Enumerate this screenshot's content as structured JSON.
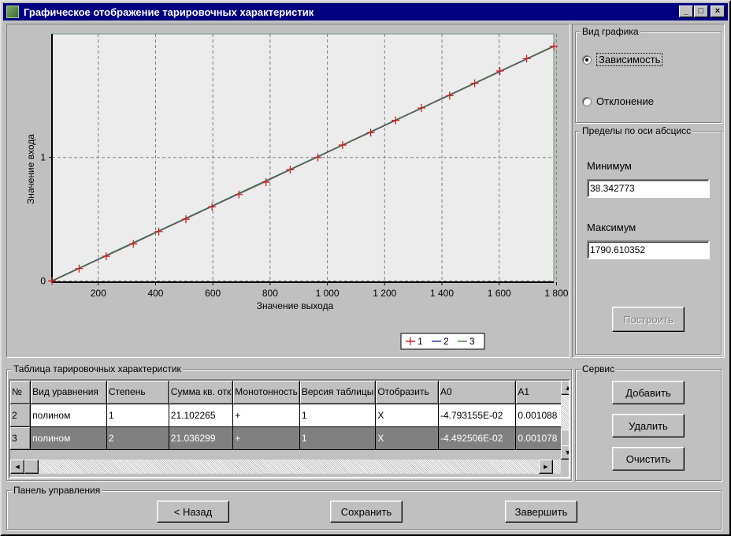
{
  "window": {
    "title": "Графическое отображение тарировочных характеристик",
    "min_glyph": "_",
    "max_glyph": "□",
    "close_glyph": "×"
  },
  "chart_data": {
    "type": "line",
    "xlabel": "Значение выхода",
    "ylabel": "Значение входа",
    "x_ticks": [
      "200",
      "400",
      "600",
      "800",
      "1 000",
      "1 200",
      "1 400",
      "1 600",
      "1 800"
    ],
    "x_tick_values": [
      200,
      400,
      600,
      800,
      1000,
      1200,
      1400,
      1600,
      1800
    ],
    "y_ticks": [
      "0",
      "1"
    ],
    "y_tick_values": [
      0,
      1
    ],
    "xlim": [
      38.342773,
      1790.610352
    ],
    "ylim": [
      -0.01,
      2.0
    ],
    "grid": true,
    "legend_position": "bottom-right",
    "series": [
      {
        "name": "1",
        "color": "#cc2222",
        "marker": "+",
        "x": [
          38.3,
          133.1,
          227.6,
          322.4,
          411.2,
          506.0,
          597.3,
          691.0,
          785.6,
          870.2,
          966.9,
          1053.0,
          1151.3,
          1238.3,
          1328.6,
          1427.0,
          1514.3,
          1602.5,
          1695.7,
          1790.6
        ],
        "y": [
          0.0,
          0.1,
          0.2,
          0.3,
          0.4,
          0.5,
          0.6,
          0.7,
          0.8,
          0.9,
          1.0,
          1.1,
          1.2,
          1.3,
          1.4,
          1.5,
          1.6,
          1.7,
          1.8,
          1.9
        ]
      },
      {
        "name": "2",
        "color": "#2a3f9a",
        "x": [
          38.3,
          1790.6
        ],
        "y": [
          0.0,
          1.9
        ]
      },
      {
        "name": "3",
        "color": "#4f8a4f",
        "x": [
          38.3,
          1790.6
        ],
        "y": [
          0.0,
          1.9
        ]
      }
    ]
  },
  "chart_type": {
    "group_label": "Вид графика",
    "options": [
      {
        "label": "Зависимость",
        "selected": true
      },
      {
        "label": "Отклонение",
        "selected": false
      }
    ]
  },
  "x_limits": {
    "group_label": "Пределы по оси абсцисс",
    "min_label": "Минимум",
    "min_value": "38.342773",
    "max_label": "Максимум",
    "max_value": "1790.610352",
    "build_button": "Построить"
  },
  "table": {
    "group_label": "Таблица тарировочных характеристик",
    "columns": [
      "№",
      "Вид уравнения",
      "Степень",
      "Сумма кв. отк",
      "Монотонность",
      "Версия таблицы",
      "Отобразить",
      "A0",
      "A1"
    ],
    "rows": [
      [
        "2",
        "полином",
        "1",
        "21.102265",
        "+",
        "1",
        "X",
        "-4.793155E-02",
        "0.001088"
      ],
      [
        "3",
        "полином",
        "2",
        "21.036299",
        "+",
        "1",
        "X",
        "-4.492506E-02",
        "0.001078"
      ]
    ],
    "arrows": {
      "up": "▲",
      "down": "▼",
      "left": "◄",
      "right": "►"
    }
  },
  "service": {
    "group_label": "Сервис",
    "add": "Добавить",
    "delete": "Удалить",
    "clear": "Очистить"
  },
  "control_panel": {
    "group_label": "Панель управления",
    "back": "< Назад",
    "save": "Сохранить",
    "finish": "Завершить"
  }
}
